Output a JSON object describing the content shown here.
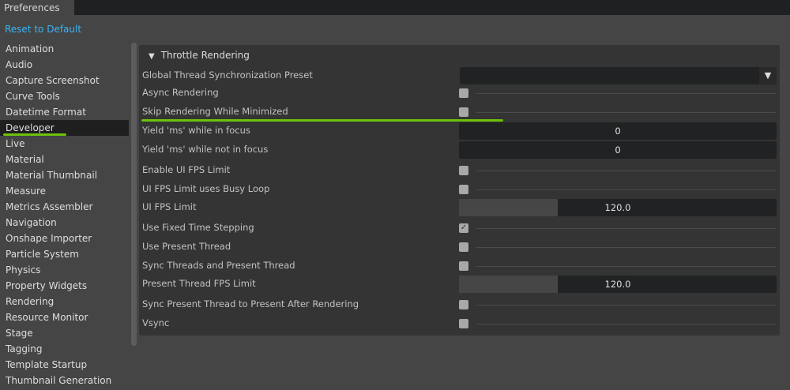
{
  "window": {
    "tab": "Preferences",
    "reset": "Reset to Default"
  },
  "sidebar": {
    "selected": "Developer",
    "items": [
      "Animation",
      "Audio",
      "Capture Screenshot",
      "Curve Tools",
      "Datetime Format",
      "Developer",
      "Live",
      "Material",
      "Material Thumbnail",
      "Measure",
      "Metrics Assembler",
      "Navigation",
      "Onshape Importer",
      "Particle System",
      "Physics",
      "Property Widgets",
      "Rendering",
      "Resource Monitor",
      "Stage",
      "Tagging",
      "Template Startup",
      "Thumbnail Generation"
    ]
  },
  "section": {
    "title": "Throttle Rendering",
    "collapse_icon": "▼"
  },
  "rows": [
    {
      "label": "Global Thread Synchronization Preset",
      "type": "dropdown",
      "value": ""
    },
    {
      "label": "Async Rendering",
      "type": "checkbox",
      "checked": false
    },
    {
      "label": "Skip Rendering While Minimized",
      "type": "checkbox",
      "checked": false
    },
    {
      "label": "Yield 'ms' while in focus",
      "type": "number",
      "value": "0"
    },
    {
      "label": "Yield 'ms' while not in focus",
      "type": "number",
      "value": "0"
    },
    {
      "label": "Enable UI FPS Limit",
      "type": "checkbox",
      "checked": false
    },
    {
      "label": "UI FPS Limit uses Busy Loop",
      "type": "checkbox",
      "checked": false
    },
    {
      "label": "UI FPS Limit",
      "type": "slider",
      "value": "120.0",
      "fill": 0.31
    },
    {
      "label": "Use Fixed Time Stepping",
      "type": "checkbox",
      "checked": true
    },
    {
      "label": "Use Present Thread",
      "type": "checkbox",
      "checked": false
    },
    {
      "label": "Sync Threads and Present Thread",
      "type": "checkbox",
      "checked": false
    },
    {
      "label": "Present Thread FPS Limit",
      "type": "slider",
      "value": "120.0",
      "fill": 0.31
    },
    {
      "label": "Sync Present Thread to Present After Rendering",
      "type": "checkbox",
      "checked": false
    },
    {
      "label": "Vsync",
      "type": "checkbox",
      "checked": false
    }
  ],
  "colors": {
    "accent": "#3ab4f2",
    "highlight": "#6cc20a"
  }
}
